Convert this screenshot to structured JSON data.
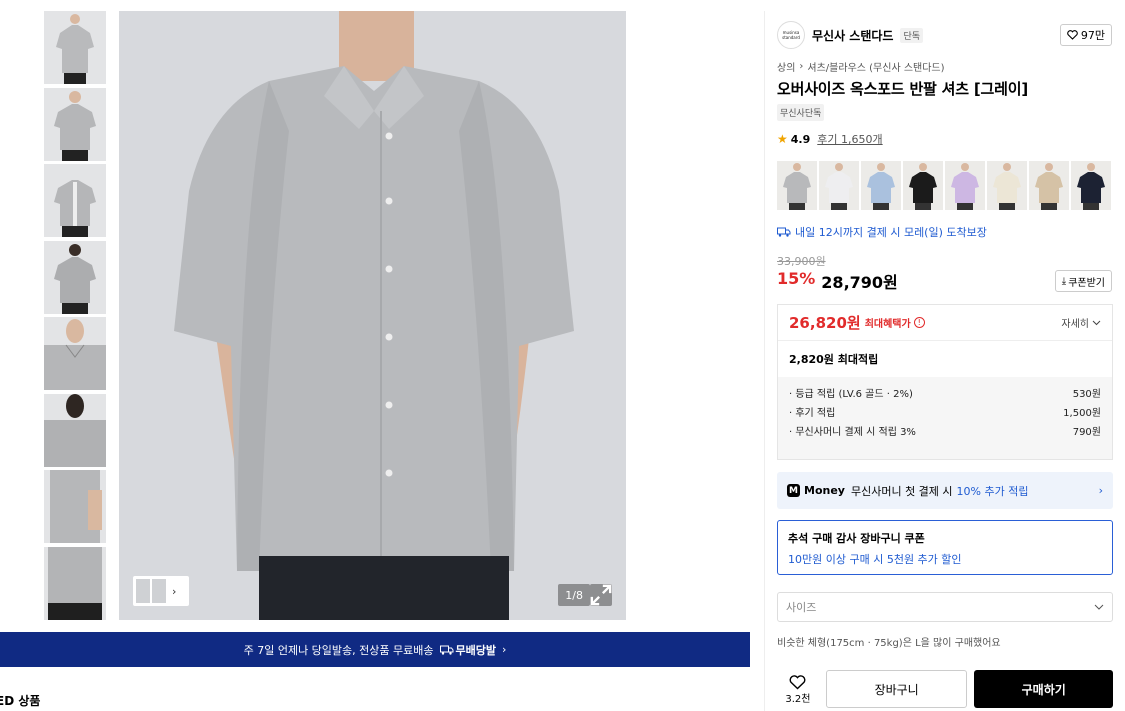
{
  "gallery": {
    "thumbnail_count": 8,
    "counter": "1/8"
  },
  "banner": {
    "text": "주 7일 언제나 당일발송, 전상품 무료배송",
    "logo_text": "무배당발",
    "chevron": "›"
  },
  "bottom_section": {
    "title": "ED 상품"
  },
  "brand": {
    "name": "무신사 스탠다드",
    "tag": "단독",
    "logo_text": "musinsa standard",
    "likes": "97만"
  },
  "breadcrumb": {
    "root": "상의",
    "sep": "›",
    "category": "셔츠/블라우스 (무신사 스탠다드)"
  },
  "product": {
    "title": "오버사이즈 옥스포드 반팔 셔츠 [그레이]",
    "badge": "무신사단독",
    "rating": "4.9",
    "reviews": "후기 1,650개"
  },
  "color_options": {
    "colors": [
      "#b8b9bb",
      "#eeeef0",
      "#aac1de",
      "#1b1b1b",
      "#cdb7e3",
      "#ece6d6",
      "#d5c2a6",
      "#1c2233"
    ]
  },
  "delivery": {
    "text": "내일 12시까지 결제 시 모레(일) 도착보장"
  },
  "price": {
    "original": "33,900원",
    "discount_rate": "15%",
    "sale": "28,790원",
    "coupon_button": "쿠폰받기"
  },
  "benefit": {
    "max_price": "26,820원",
    "max_label": "최대혜택가",
    "detail_label": "자세히",
    "points_total": "2,820원 최대적립",
    "points": [
      {
        "label": "· 등급 적립 (LV.6 골드 · 2%)",
        "value": "530원"
      },
      {
        "label": "· 후기 적립",
        "value": "1,500원"
      },
      {
        "label": "· 무신사머니 결제 시 적립 3%",
        "value": "790원"
      }
    ]
  },
  "money_promo": {
    "logo": "M",
    "name": "Money",
    "text_prefix": "무신사머니 첫 결제 시",
    "highlight": "10% 추가 적립"
  },
  "coupon_promo": {
    "title": "추석 구매 감사 장바구니 쿠폰",
    "subtitle": "10만원 이상 구매 시 5천원 추가 할인"
  },
  "size": {
    "placeholder": "사이즈",
    "tip": "비슷한 체형(175cm · 75kg)은 L을 많이 구매했어요"
  },
  "actions": {
    "fav_count": "3.2천",
    "cart_label": "장바구니",
    "buy_label": "구매하기"
  }
}
